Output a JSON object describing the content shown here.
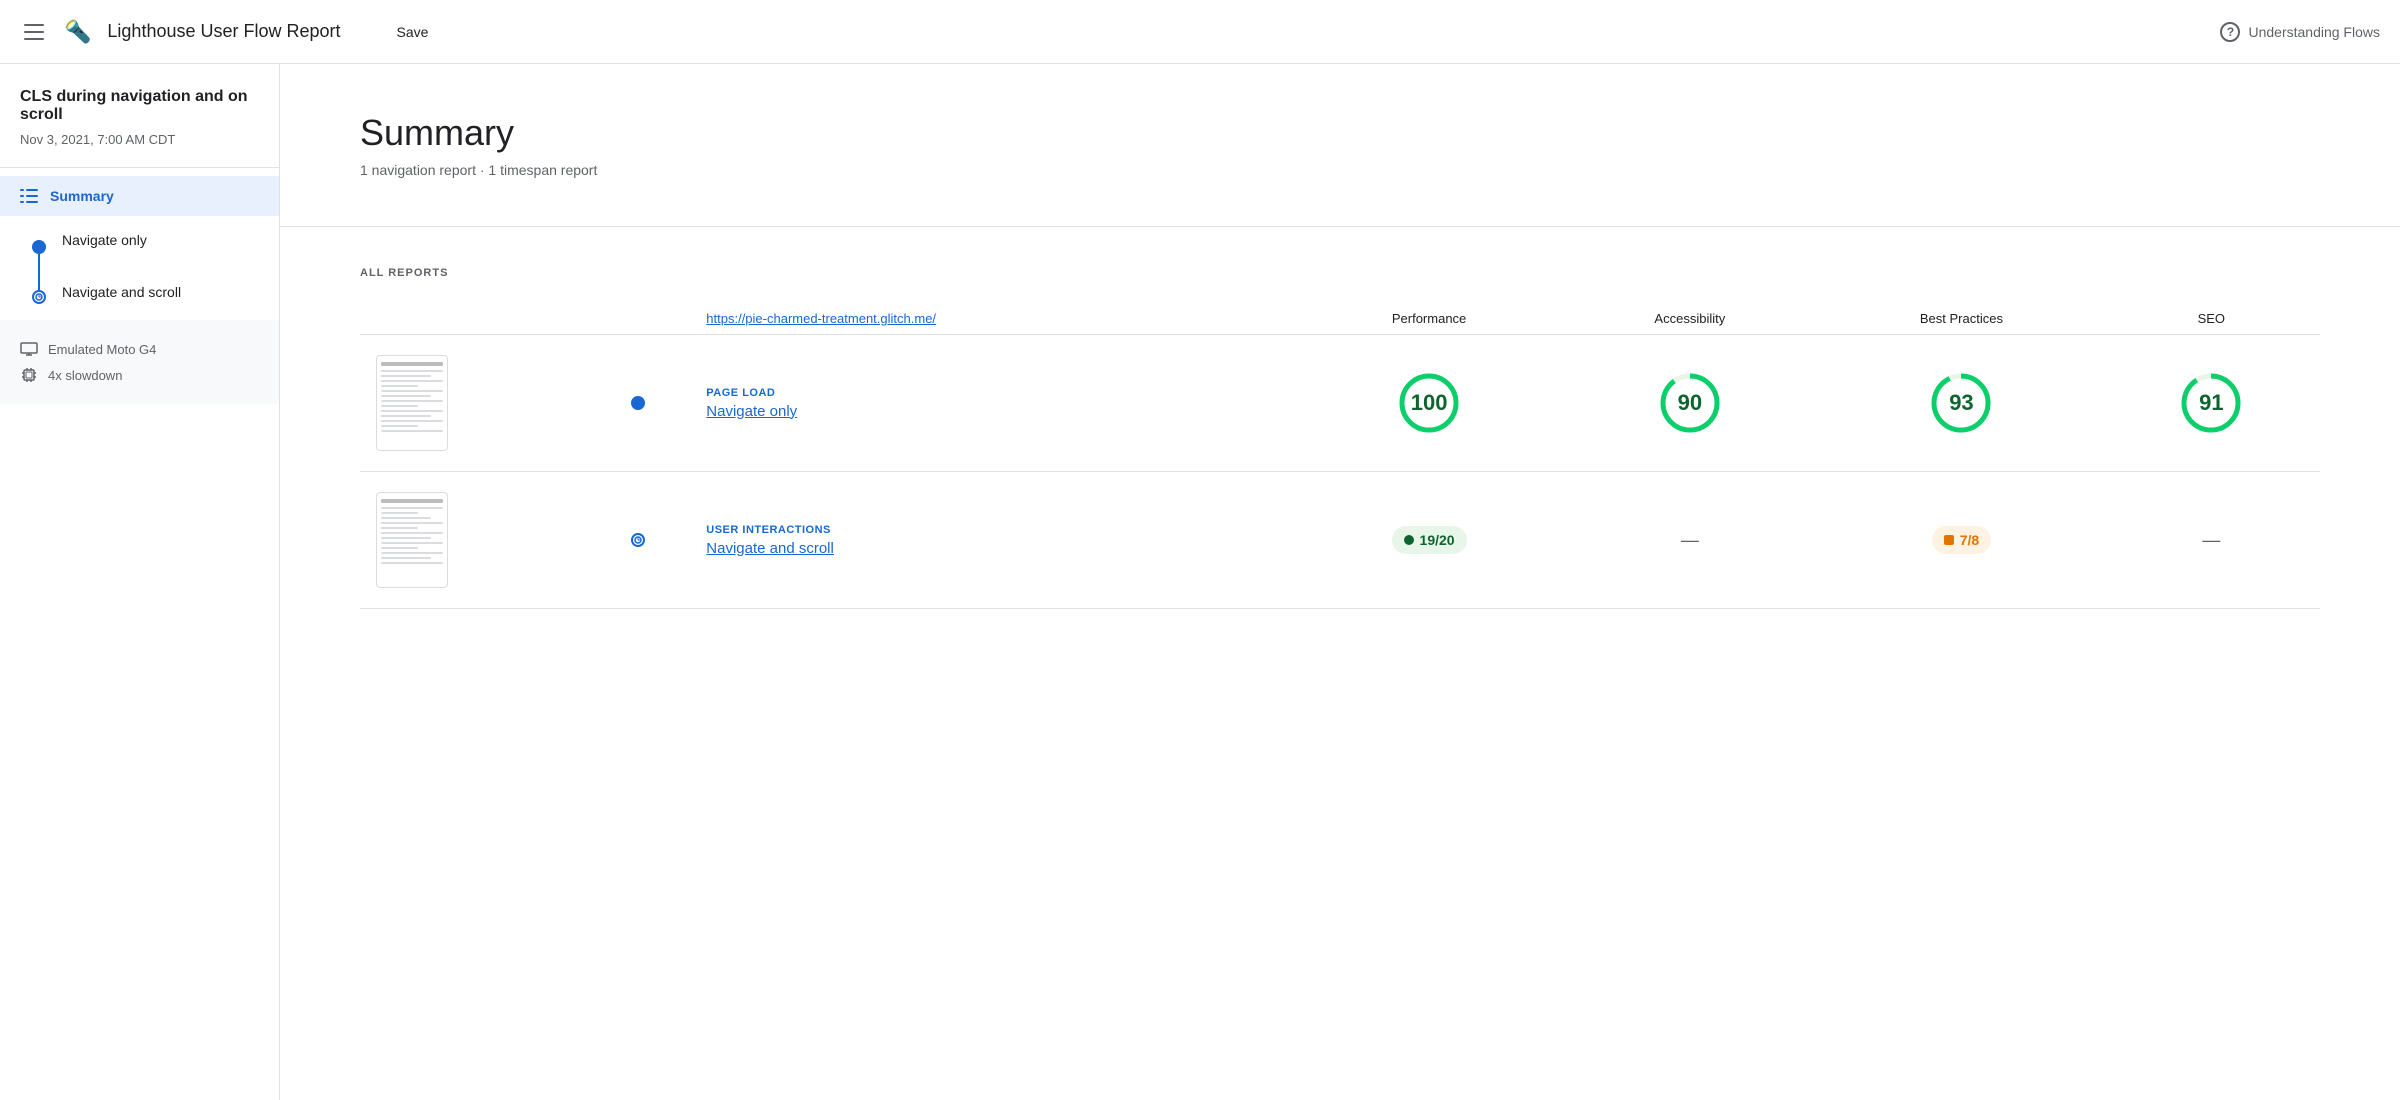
{
  "header": {
    "menu_icon": "hamburger",
    "logo": "🔦",
    "title": "Lighthouse User Flow Report",
    "save_label": "Save",
    "help_label": "Understanding Flows"
  },
  "sidebar": {
    "project_title": "CLS during navigation and on scroll",
    "date": "Nov 3, 2021, 7:00 AM CDT",
    "summary_label": "Summary",
    "flows": [
      {
        "label": "Navigate only",
        "type": "dot"
      },
      {
        "label": "Navigate and scroll",
        "type": "clock"
      }
    ],
    "device_info": [
      {
        "icon": "monitor",
        "label": "Emulated Moto G4"
      },
      {
        "icon": "cpu",
        "label": "4x slowdown"
      }
    ]
  },
  "summary": {
    "title": "Summary",
    "subtitle": "1 navigation report · 1 timespan report"
  },
  "reports": {
    "section_label": "ALL REPORTS",
    "url": "https://pie-charmed-treatment.glitch.me/",
    "columns": [
      "Performance",
      "Accessibility",
      "Best Practices",
      "SEO"
    ],
    "rows": [
      {
        "type": "Page load",
        "name": "Navigate only",
        "scores": [
          {
            "value": "100",
            "kind": "circle",
            "color": "green"
          },
          {
            "value": "90",
            "kind": "circle",
            "color": "green"
          },
          {
            "value": "93",
            "kind": "circle",
            "color": "green"
          },
          {
            "value": "91",
            "kind": "circle",
            "color": "green"
          }
        ]
      },
      {
        "type": "User interactions",
        "name": "Navigate and scroll",
        "scores": [
          {
            "value": "19/20",
            "kind": "fraction",
            "color": "green"
          },
          {
            "value": "—",
            "kind": "dash"
          },
          {
            "value": "7/8",
            "kind": "fraction",
            "color": "orange"
          },
          {
            "value": "—",
            "kind": "dash"
          }
        ]
      }
    ]
  }
}
